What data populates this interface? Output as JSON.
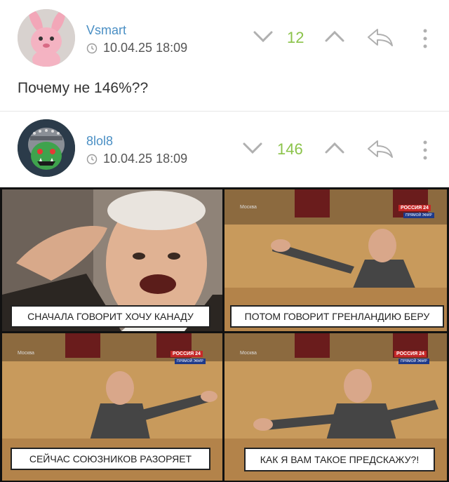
{
  "comments": [
    {
      "username": "Vsmart",
      "date": "10.04.25 18:09",
      "score": "12",
      "text": "Почему не 146%??",
      "avatar_icon": "pink-rabbit-avatar-icon"
    },
    {
      "username": "8lol8",
      "date": "10.04.25 18:09",
      "score": "146",
      "avatar_icon": "orc-knight-avatar-icon"
    }
  ],
  "meme": {
    "captions": [
      "СНАЧАЛА ГОВОРИТ ХОЧУ КАНАДУ",
      "ПОТОМ ГОВОРИТ ГРЕНЛАНДИЮ БЕРУ",
      "СЕЙЧАС СОЮЗНИКОВ РАЗОРЯЕТ",
      "КАК Я ВАМ ТАКОЕ ПРЕДСКАЖУ?!"
    ],
    "channel_logo": "РОССИЯ 24",
    "channel_sub": "ПРЯМОЙ ЭФИР",
    "watermark": "Москва"
  },
  "colors": {
    "accent_link": "#4a8fc4",
    "score_positive": "#8bc34a",
    "icon_gray": "#b0b0b0"
  }
}
